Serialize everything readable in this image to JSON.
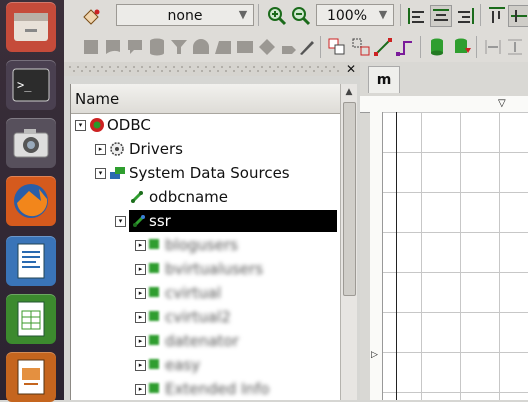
{
  "launcher": {
    "items": [
      {
        "name": "files-icon"
      },
      {
        "name": "terminal-icon"
      },
      {
        "name": "camera-icon"
      },
      {
        "name": "firefox-icon"
      },
      {
        "name": "writer-icon"
      },
      {
        "name": "calc-icon"
      },
      {
        "name": "impress-icon"
      }
    ]
  },
  "toolbar": {
    "style_combo": "none",
    "zoom_combo": "100%"
  },
  "tree": {
    "header": "Name",
    "nodes": {
      "odbc": "ODBC",
      "drivers": "Drivers",
      "sds": "System Data Sources",
      "odbcname": "odbcname",
      "ssr": "ssr",
      "c1": "blogusers",
      "c2": "bvirtualusers",
      "c3": "cvirtual",
      "c4": "cvirtual2",
      "c5": "datenator",
      "c6": "easy",
      "c7": "Extended Info"
    }
  },
  "canvas_tab": "m",
  "colors": {
    "selection": "#000000",
    "launcher": "#33283a",
    "green": "#2f9e2f"
  }
}
